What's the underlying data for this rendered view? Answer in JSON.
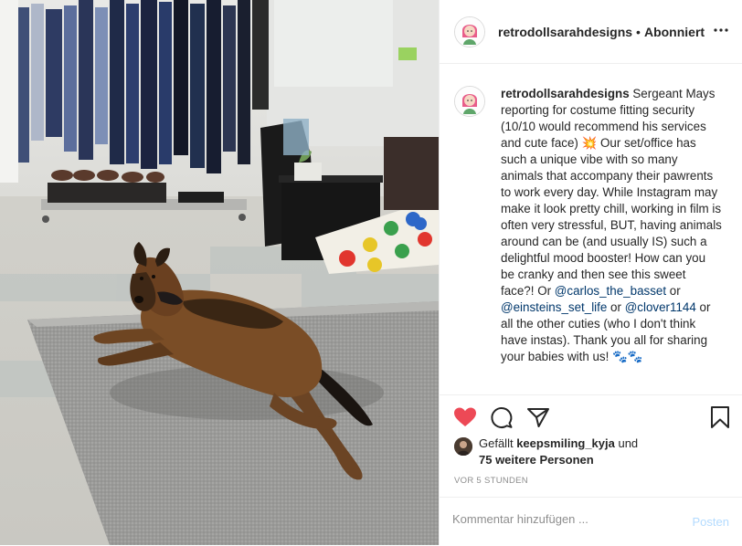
{
  "colors": {
    "accent": "#0095f6",
    "like": "#ed4956",
    "link": "#00376b",
    "muted": "#8e8e8e",
    "post_disabled": "#b3dbff"
  },
  "header": {
    "username": "retrodollsarahdesigns",
    "separator": "•",
    "follow_status": "Abonniert",
    "more_icon": "ellipsis-icon"
  },
  "caption": {
    "username": "retrodollsarahdesigns",
    "text_1": " Sergeant Mays reporting for costume fitting security (10/10 would recommend his services and cute face) ",
    "emoji_1": "💥",
    "text_2": " Our set/office has such a unique vibe with so many animals that accompany their pawrents to work every day. While Instagram may make it look pretty chill, working in film is often very stressful, BUT, having animals around can be (and usually IS) such a delightful mood booster! How can you be cranky and then see this sweet face?! Or ",
    "mention_1": "@carlos_the_basset",
    "text_3": " or ",
    "mention_2": "@einsteins_set_life",
    "text_4": " or ",
    "mention_3": "@clover1144",
    "text_5": " or all the other cuties (who I don't think have instas). Thank you all for sharing your babies with us! ",
    "emoji_2": "🐾🐾"
  },
  "actions": {
    "like_icon": "heart-icon",
    "comment_icon": "comment-icon",
    "share_icon": "share-icon",
    "save_icon": "bookmark-icon",
    "liked": true
  },
  "likes": {
    "prefix": "Gefällt ",
    "liker": "keepsmiling_kyja",
    "mid": " und",
    "others": "75 weitere Personen"
  },
  "timestamp": "VOR 5 STUNDEN",
  "comment": {
    "placeholder": "Kommentar hinzufügen ...",
    "post_label": "Posten"
  }
}
